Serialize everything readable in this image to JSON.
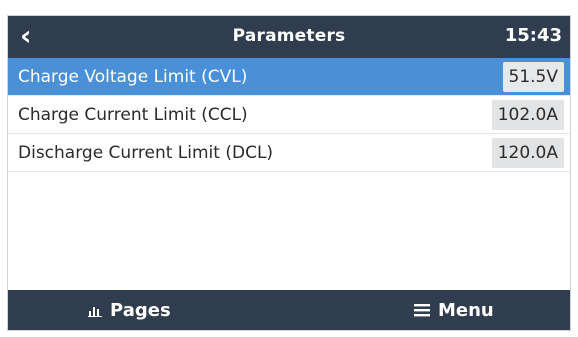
{
  "header": {
    "back_icon": "chevron-left-icon",
    "title": "Parameters",
    "time": "15:43"
  },
  "params": [
    {
      "label": "Charge Voltage Limit (CVL)",
      "value": "51.5V",
      "selected": true
    },
    {
      "label": "Charge Current Limit (CCL)",
      "value": "102.0A",
      "selected": false
    },
    {
      "label": "Discharge Current Limit (DCL)",
      "value": "120.0A",
      "selected": false
    }
  ],
  "footer": {
    "pages_label": "Pages",
    "pages_icon": "bar-chart-icon",
    "menu_label": "Menu",
    "menu_icon": "hamburger-menu-icon"
  },
  "colors": {
    "bar_bg": "#2f3d4e",
    "selected_bg": "#4a90d9",
    "value_bg": "#e1e3e5"
  }
}
